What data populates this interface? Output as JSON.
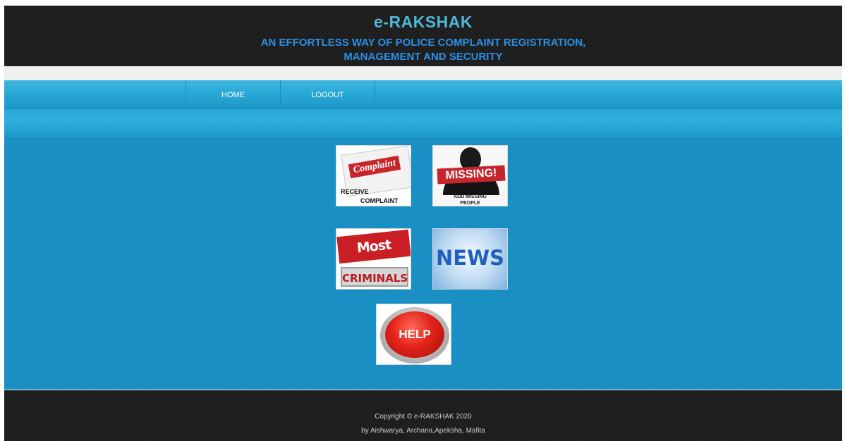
{
  "header": {
    "title": "e-RAKSHAK",
    "tagline_line1": "AN EFFORTLESS WAY OF POLICE COMPLAINT REGISTRATION,",
    "tagline_line2": "MANAGEMENT AND SECURITY"
  },
  "nav": {
    "home": "HOME",
    "logout": "LOGOUT"
  },
  "tiles": {
    "complaint": {
      "stamp": "Complaint",
      "line1": "RECEIVE",
      "line2": "COMPLAINT"
    },
    "missing": {
      "label": "MISSING!",
      "line1": "ADD MISSING",
      "line2": "PEOPLE"
    },
    "wanted": {
      "top": "Most Wanted",
      "bottom": "CRIMINALS"
    },
    "news": {
      "label": "NEWS"
    },
    "help": {
      "label": "HELP"
    }
  },
  "footer": {
    "copyright": "Copyright © e-RAKSHAK 2020",
    "authors": "by Aishwarya, Archana,Apeksha, Mafita"
  },
  "colors": {
    "title": "#4db8d8",
    "tagline": "#2b8fe6",
    "nav": "#27a6d3",
    "main_bg": "#1a8fc3",
    "footer_bg": "#1b1b1b"
  }
}
